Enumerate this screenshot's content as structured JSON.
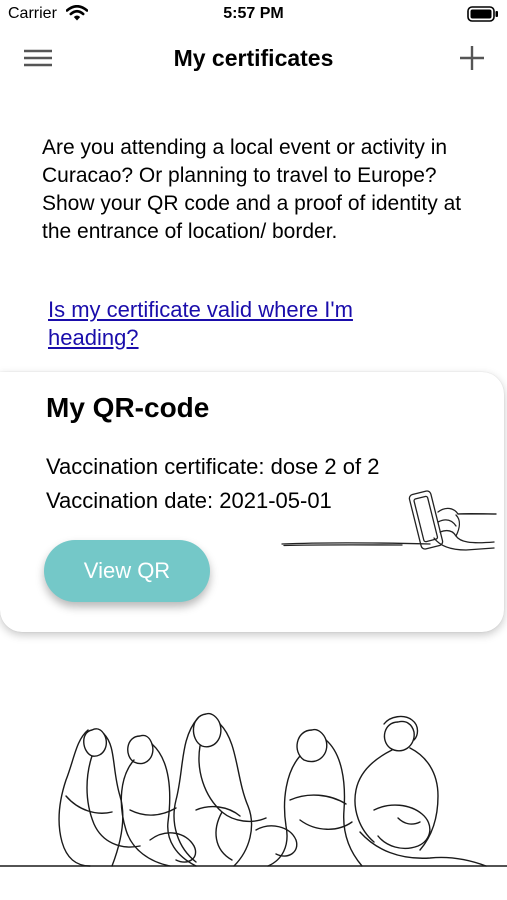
{
  "status_bar": {
    "carrier": "Carrier",
    "time": "5:57 PM"
  },
  "nav": {
    "title": "My certificates",
    "menu_icon": "hamburger-menu-icon",
    "add_icon": "plus-icon"
  },
  "intro": {
    "text": "Are you attending a local event or activity in Curacao? Or planning to travel to Europe? Show your QR code and a proof of identity at the entrance of location/ border."
  },
  "validity_link": {
    "text": "Is my certificate valid where I'm heading?"
  },
  "qr_card": {
    "title": "My QR-code",
    "certificate": "Vaccination certificate: dose 2 of 2",
    "date": "Vaccination date: 2021-05-01",
    "button_label": "View QR",
    "button_color": "#74c8c8"
  },
  "colors": {
    "link": "#1a0dab",
    "accent": "#74c8c8"
  }
}
